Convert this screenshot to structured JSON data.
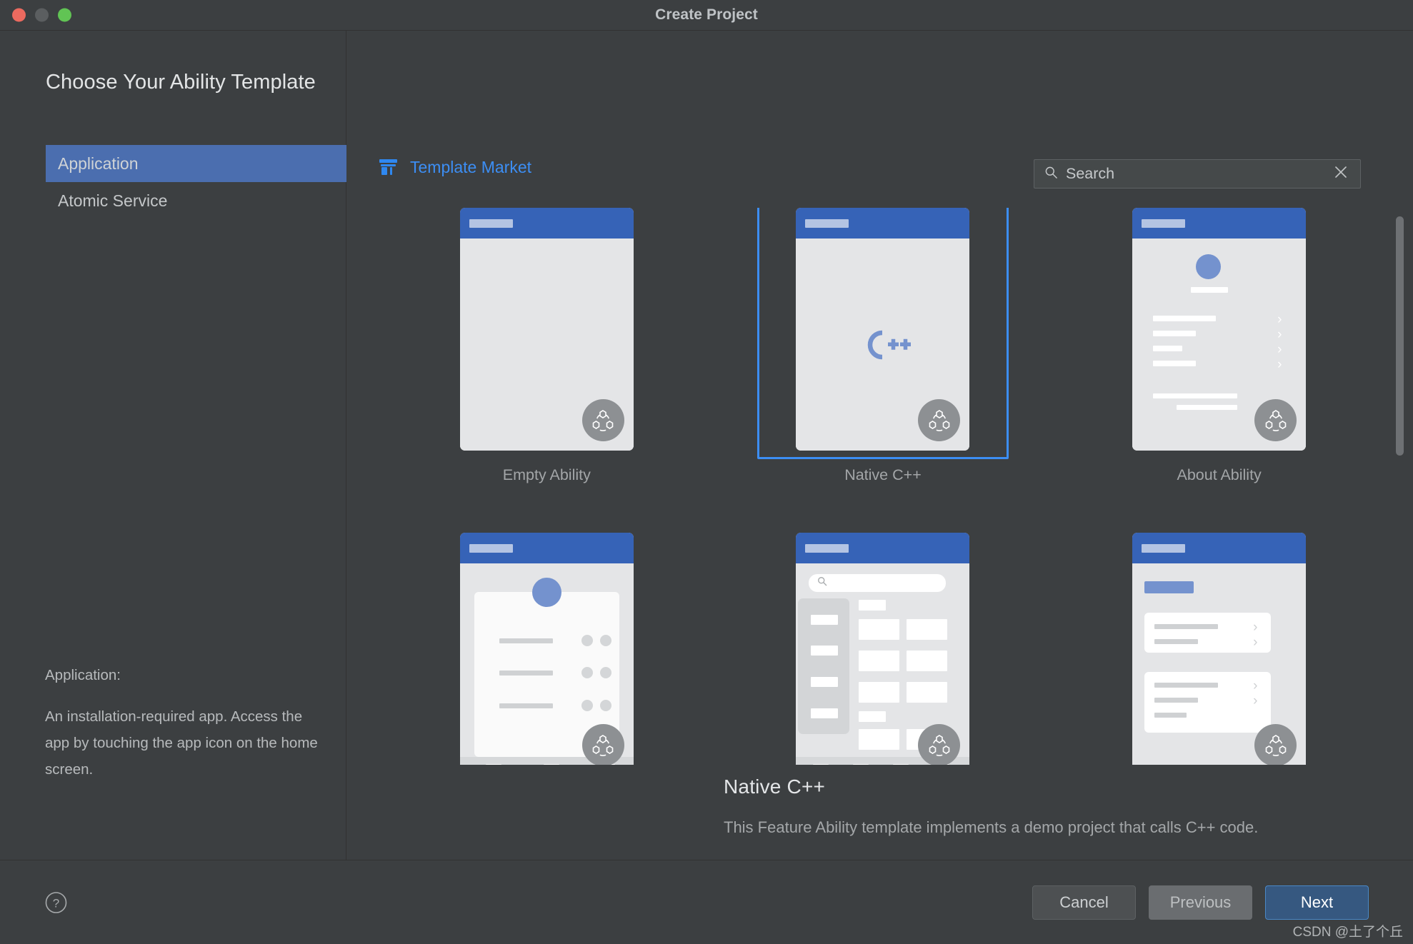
{
  "window": {
    "title": "Create Project",
    "traffic_lights": [
      "close",
      "minimize",
      "zoom"
    ]
  },
  "left_pane": {
    "heading": "Choose Your Ability Template",
    "nav_items": [
      {
        "label": "Application",
        "selected": true
      },
      {
        "label": "Atomic Service",
        "selected": false
      }
    ],
    "description_title": "Application:",
    "description_body": "An installation-required app. Access the app by touching the app icon on the home screen."
  },
  "right_pane": {
    "market_link_label": "Template Market",
    "market_icon": "shop-icon",
    "search": {
      "placeholder": "Search",
      "value": "",
      "icon": "search-icon",
      "clear_icon": "close-icon"
    },
    "templates": [
      {
        "label": "Empty Ability",
        "mock": "empty",
        "selected": false
      },
      {
        "label": "Native C++",
        "mock": "nativecpp",
        "selected": true
      },
      {
        "label": "About Ability",
        "mock": "about",
        "selected": false
      },
      {
        "label": "",
        "mock": "profile",
        "selected": false
      },
      {
        "label": "",
        "mock": "catalog",
        "selected": false
      },
      {
        "label": "",
        "mock": "settings",
        "selected": false
      }
    ],
    "selected_detail": {
      "title": "Native C++",
      "description": "This Feature Ability template implements a demo project that calls C++ code."
    }
  },
  "footer": {
    "help_icon": "question-circle-icon",
    "buttons": [
      {
        "label": "Cancel",
        "style": "cancel"
      },
      {
        "label": "Previous",
        "style": "previous"
      },
      {
        "label": "Next",
        "style": "next"
      }
    ]
  },
  "watermark": "CSDN @土了个丘",
  "colors": {
    "window_bg": "#3c3f41",
    "accent_blue": "#3c8ef4",
    "nav_selected": "#4b6eaf",
    "phone_header": "#3663b7",
    "next_button": "#365880"
  }
}
